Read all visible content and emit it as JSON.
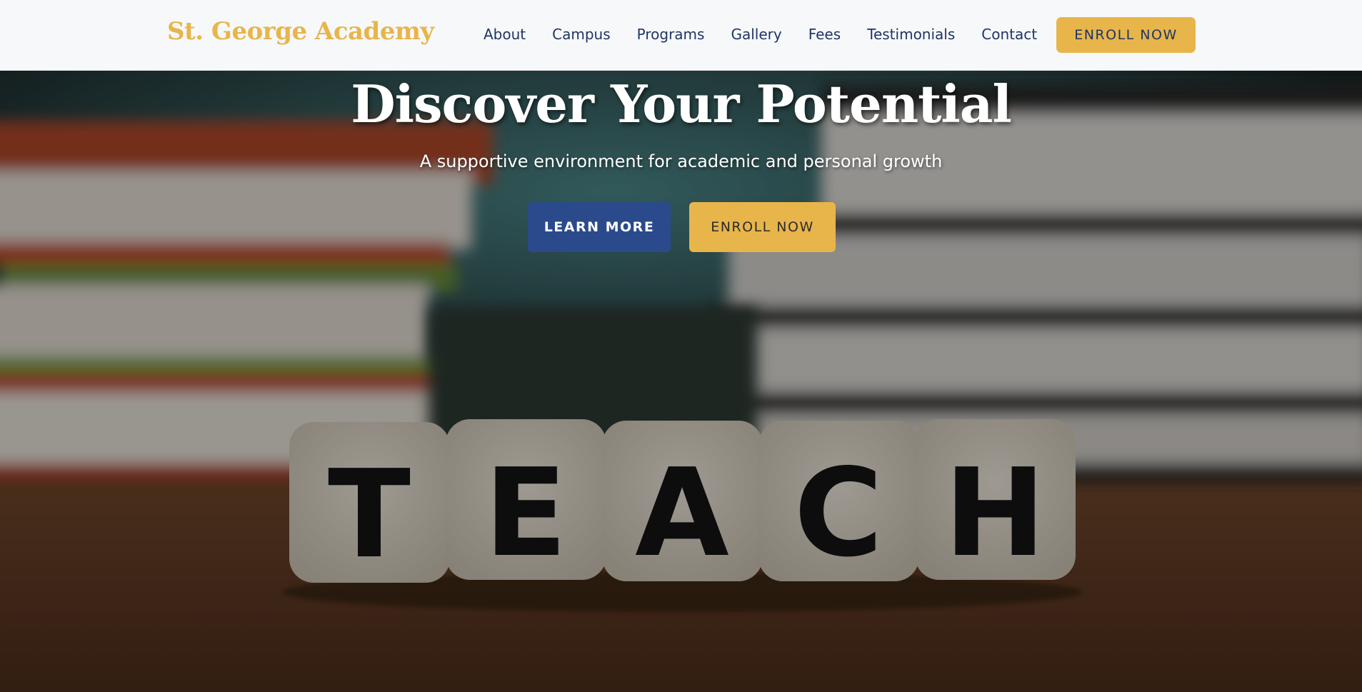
{
  "header": {
    "logo_text": "St. George Academy",
    "nav_items": [
      {
        "label": "About"
      },
      {
        "label": "Campus"
      },
      {
        "label": "Programs"
      },
      {
        "label": "Gallery"
      },
      {
        "label": "Fees"
      },
      {
        "label": "Testimonials"
      },
      {
        "label": "Contact"
      }
    ],
    "enroll_label": "ENROLL NOW"
  },
  "hero": {
    "title": "Discover Your Potential",
    "subtitle": "A supportive environment for academic and personal growth",
    "learn_more_label": "LEARN MORE",
    "enroll_label": "ENROLL NOW",
    "background_image_text": "TEACH"
  },
  "colors": {
    "brand_gold": "#e8b54a",
    "brand_navy": "#1f3566",
    "button_blue": "#2a4a8c",
    "nav_background": "#f7f8fa"
  }
}
